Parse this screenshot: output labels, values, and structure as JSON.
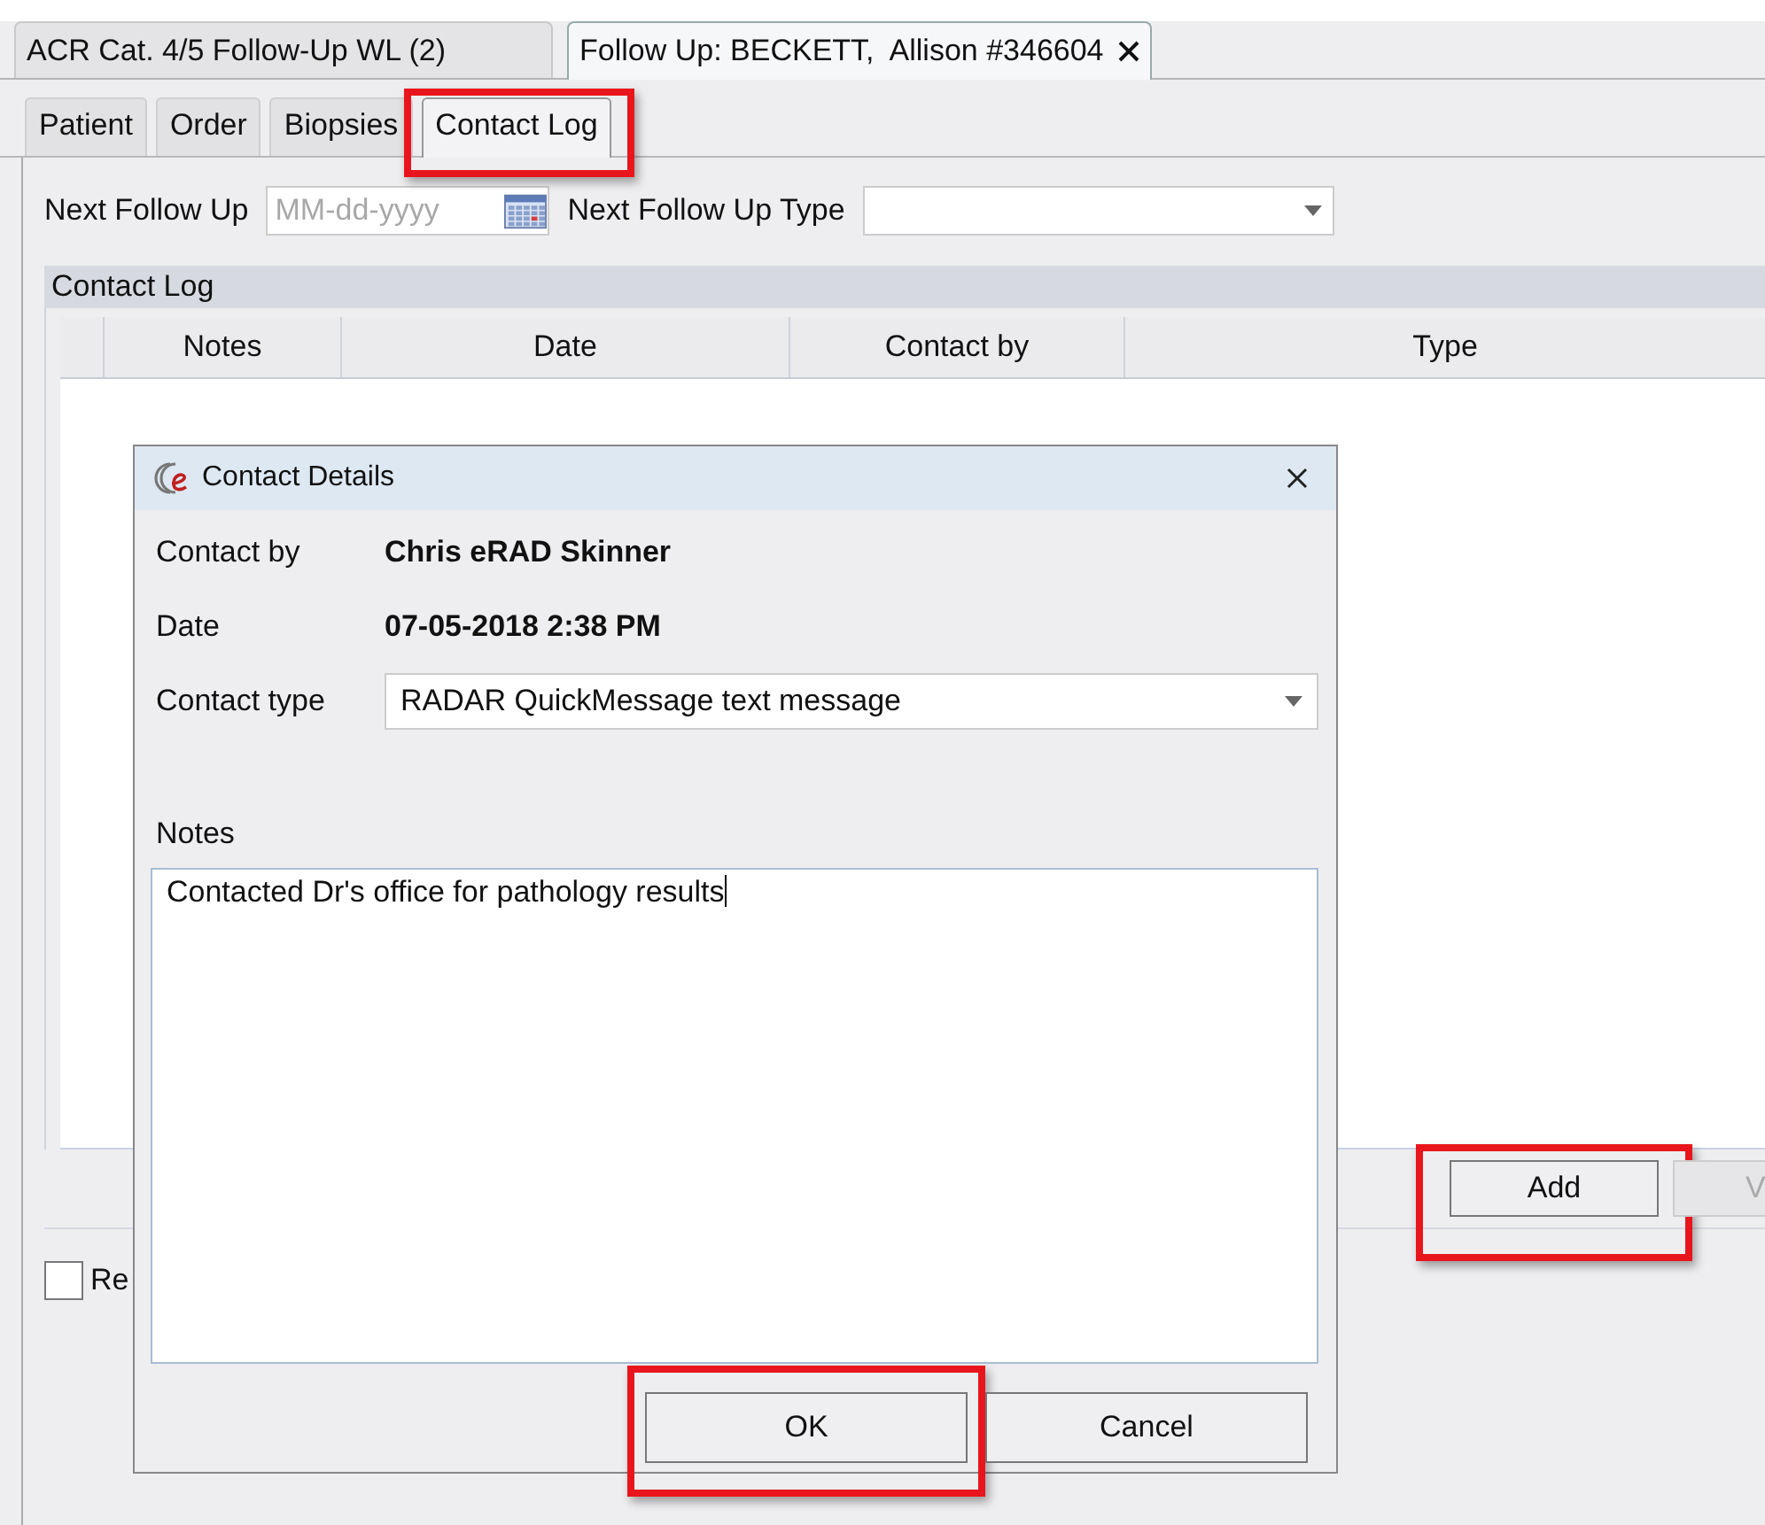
{
  "top_tabs": [
    {
      "label": "ACR Cat. 4/5 Follow-Up WL (2)",
      "selected": false,
      "closable": false
    },
    {
      "label": "Follow Up: BECKETT,  Allison #346604",
      "selected": true,
      "closable": true
    }
  ],
  "sub_tabs": [
    {
      "label": "Patient",
      "selected": false,
      "highlighted": false
    },
    {
      "label": "Order",
      "selected": false,
      "highlighted": false
    },
    {
      "label": "Biopsies",
      "selected": false,
      "highlighted": false
    },
    {
      "label": "Contact Log",
      "selected": true,
      "highlighted": true
    }
  ],
  "next_follow_up": {
    "label": "Next Follow Up",
    "placeholder": "MM-dd-yyyy"
  },
  "next_follow_up_type": {
    "label": "Next Follow Up Type"
  },
  "contact_log": {
    "title": "Contact Log",
    "columns": [
      "Notes",
      "Date",
      "Contact by",
      "Type"
    ],
    "buttons": [
      {
        "label": "Add",
        "highlighted": true,
        "disabled": false
      },
      {
        "label": "V",
        "highlighted": false,
        "disabled": true
      }
    ]
  },
  "checkbox": {
    "label": "Re",
    "checked": false
  },
  "dialog": {
    "title": "Contact Details",
    "fields": [
      {
        "label": "Contact by",
        "value": "Chris eRAD Skinner",
        "kind": "text"
      },
      {
        "label": "Date",
        "value": "07-05-2018 2:38 PM",
        "kind": "text"
      },
      {
        "label": "Contact type",
        "value": "RADAR QuickMessage text message",
        "kind": "dropdown"
      }
    ],
    "notes": {
      "label": "Notes",
      "value": "Contacted Dr's office for pathology results"
    },
    "buttons": [
      {
        "label": "OK",
        "highlighted": true
      },
      {
        "label": "Cancel",
        "highlighted": false
      }
    ]
  }
}
